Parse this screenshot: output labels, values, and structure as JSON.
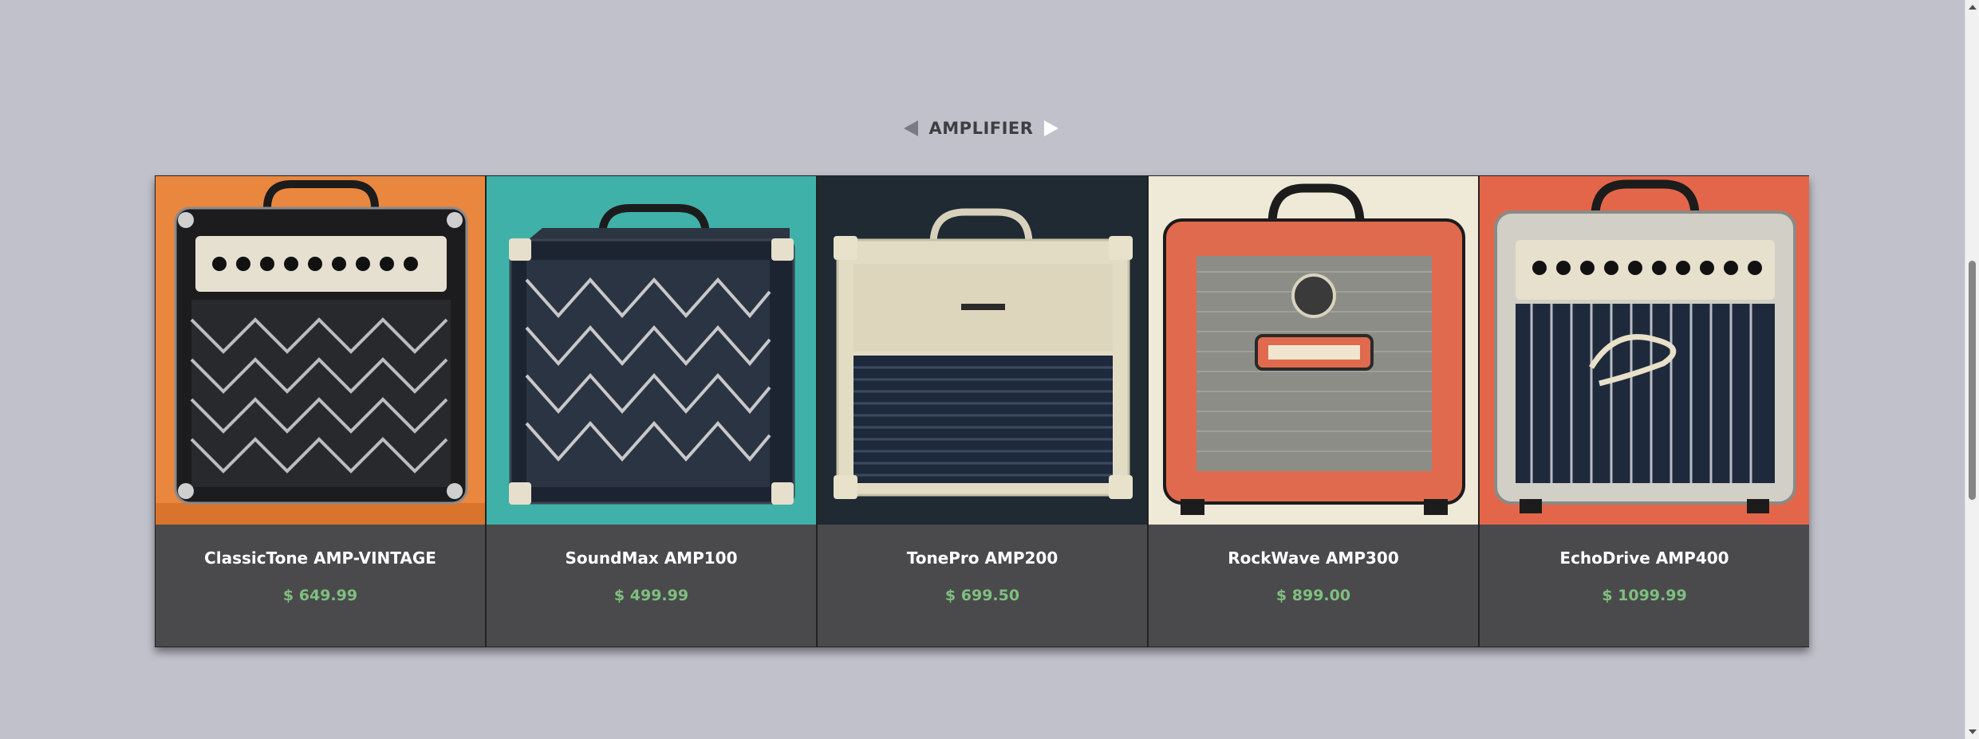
{
  "category": {
    "title": "AMPLIFIER"
  },
  "products": [
    {
      "name": "ClassicTone AMP-VINTAGE",
      "price": "$ 649.99",
      "image_icon": "vintage-amp-with-black-diamond-grille",
      "bg_color": "#e9873f"
    },
    {
      "name": "SoundMax AMP100",
      "price": "$ 499.99",
      "image_icon": "navy-amp-with-diamond-grille",
      "bg_color": "#3fb1a8"
    },
    {
      "name": "TonePro AMP200",
      "price": "$ 699.50",
      "image_icon": "cream-and-navy-amp",
      "bg_color": "#1f2a33"
    },
    {
      "name": "RockWave AMP300",
      "price": "$ 899.00",
      "image_icon": "orange-framed-amp-with-badge",
      "bg_color": "#efe9d8"
    },
    {
      "name": "EchoDrive AMP400",
      "price": "$ 1099.99",
      "image_icon": "silver-framed-amp-with-vertical-grille",
      "bg_color": "#e4664a"
    }
  ]
}
